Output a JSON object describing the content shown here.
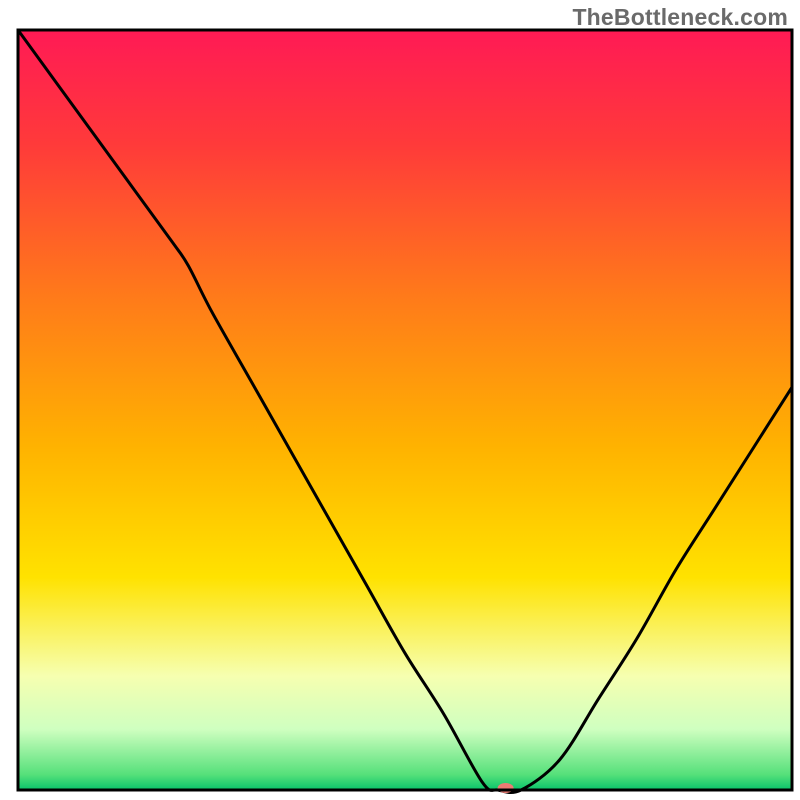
{
  "watermark": "TheBottleneck.com",
  "chart_data": {
    "type": "line",
    "title": "",
    "xlabel": "",
    "ylabel": "",
    "xlim": [
      0,
      100
    ],
    "ylim": [
      0,
      100
    ],
    "grid": false,
    "legend": false,
    "x": [
      0,
      5,
      10,
      15,
      20,
      22,
      25,
      30,
      35,
      40,
      45,
      50,
      55,
      60,
      62,
      65,
      70,
      75,
      80,
      85,
      90,
      95,
      100
    ],
    "values": [
      100,
      93,
      86,
      79,
      72,
      69,
      63,
      54,
      45,
      36,
      27,
      18,
      10,
      1,
      0,
      0,
      4,
      12,
      20,
      29,
      37,
      45,
      53
    ],
    "optimal_marker": {
      "x": 63,
      "y": 0
    },
    "gradient_stops": [
      {
        "pct": 0,
        "color": "#ff1a55"
      },
      {
        "pct": 15,
        "color": "#ff3a3a"
      },
      {
        "pct": 35,
        "color": "#ff7a1a"
      },
      {
        "pct": 55,
        "color": "#ffb300"
      },
      {
        "pct": 72,
        "color": "#ffe200"
      },
      {
        "pct": 85,
        "color": "#f6ffb0"
      },
      {
        "pct": 92,
        "color": "#cfffc0"
      },
      {
        "pct": 98,
        "color": "#55e07a"
      },
      {
        "pct": 100,
        "color": "#08c46a"
      }
    ]
  },
  "frame": {
    "stroke": "#000000",
    "width": 3
  },
  "curve": {
    "stroke": "#000000",
    "width": 3
  },
  "marker": {
    "fill": "#ec7b73",
    "rx": 8,
    "ry": 5
  }
}
